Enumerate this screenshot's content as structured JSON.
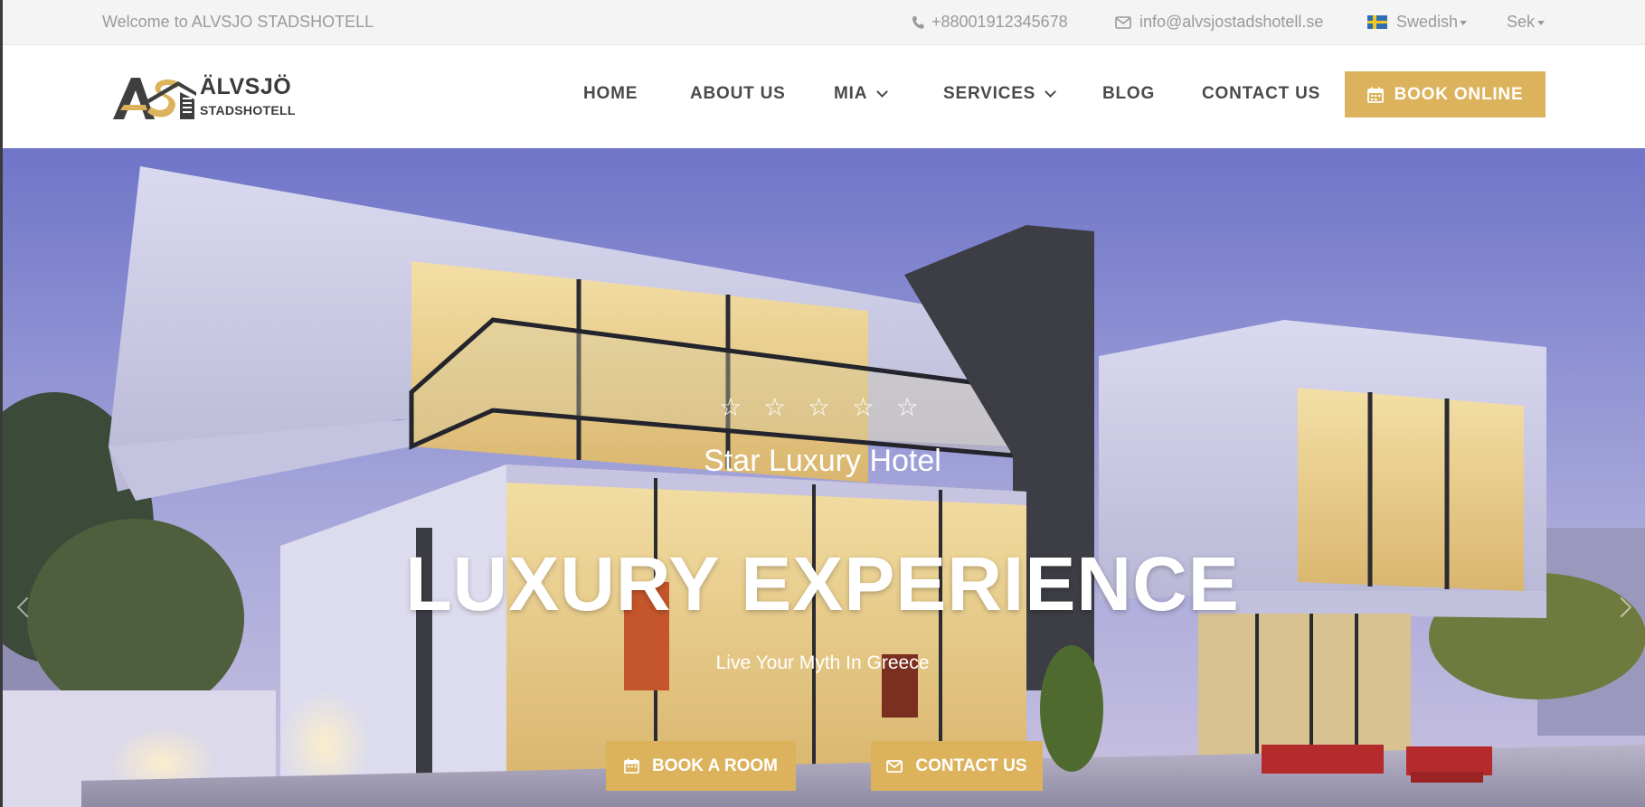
{
  "topbar": {
    "welcome": "Welcome to ALVSJO STADSHOTELL",
    "phone": "+88001912345678",
    "email": "info@alvsjostadshotell.se",
    "language": "Swedish",
    "currency": "Sek",
    "icons": {
      "phone": "phone-icon",
      "email": "envelope-icon",
      "flag": "swedish-flag-icon"
    }
  },
  "logo": {
    "line1": "ÄLVSJÖ",
    "line2": "STADSHOTELL"
  },
  "nav": {
    "items": [
      {
        "label": "HOME"
      },
      {
        "label": "ABOUT US"
      },
      {
        "label": "MIA"
      },
      {
        "label": "SERVICES"
      },
      {
        "label": "BLOG"
      },
      {
        "label": "CONTACT US"
      }
    ],
    "book_online": "BOOK ONLINE"
  },
  "hero": {
    "stars": "☆ ☆ ☆ ☆ ☆",
    "subtitle": "Star Luxury Hotel",
    "headline": "LUXURY EXPERIENCE",
    "tagline": "Live Your Myth In Greece",
    "book_button": "BOOK A ROOM",
    "contact_button": "CONTACT US"
  },
  "colors": {
    "accent": "#dcb35c",
    "text_dark": "#4a4a4a",
    "topbar_bg": "#f4f4f4",
    "topbar_text": "#9a9a9a"
  }
}
